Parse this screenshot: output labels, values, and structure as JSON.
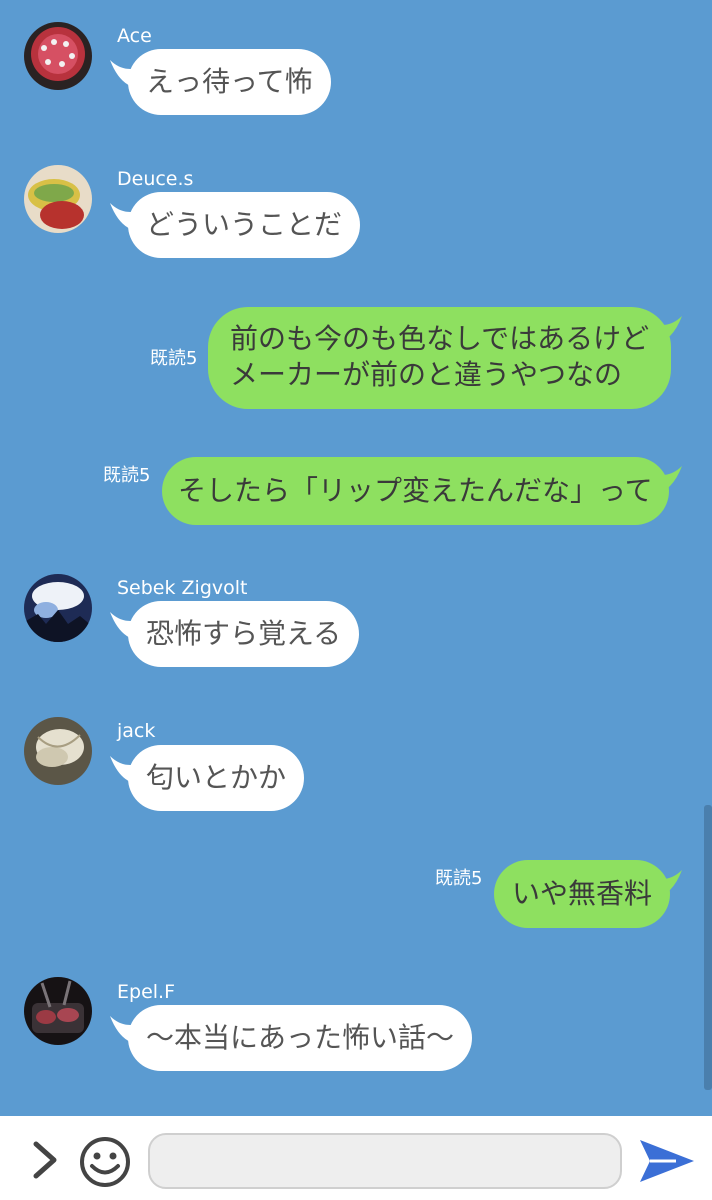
{
  "messages": [
    {
      "sender": "Ace",
      "text": "えっ待って怖"
    },
    {
      "sender": "Deuce.s",
      "text": "どういうことだ"
    },
    {
      "read": "既読5",
      "lines": [
        "前のも今のも色なしではあるけど",
        "メーカーが前のと違うやつなの"
      ]
    },
    {
      "read": "既読5",
      "text": "そしたら「リップ変えたんだな」って"
    },
    {
      "sender": "Sebek Zigvolt",
      "text": "恐怖すら覚える"
    },
    {
      "sender": "jack",
      "text": "匂いとかか"
    },
    {
      "read": "既読5",
      "text": "いや無香料"
    },
    {
      "sender": "Epel.F",
      "text": "〜本当にあった怖い話〜"
    }
  ],
  "composer": {
    "placeholder": ""
  },
  "icons": {
    "expand": "chevron-right-icon",
    "emoji": "smiley-icon",
    "send": "send-arrow-icon"
  },
  "colors": {
    "background": "#5b9bd1",
    "incoming_bubble": "#ffffff",
    "outgoing_bubble": "#8ee060",
    "send_icon": "#3b6fd6"
  }
}
